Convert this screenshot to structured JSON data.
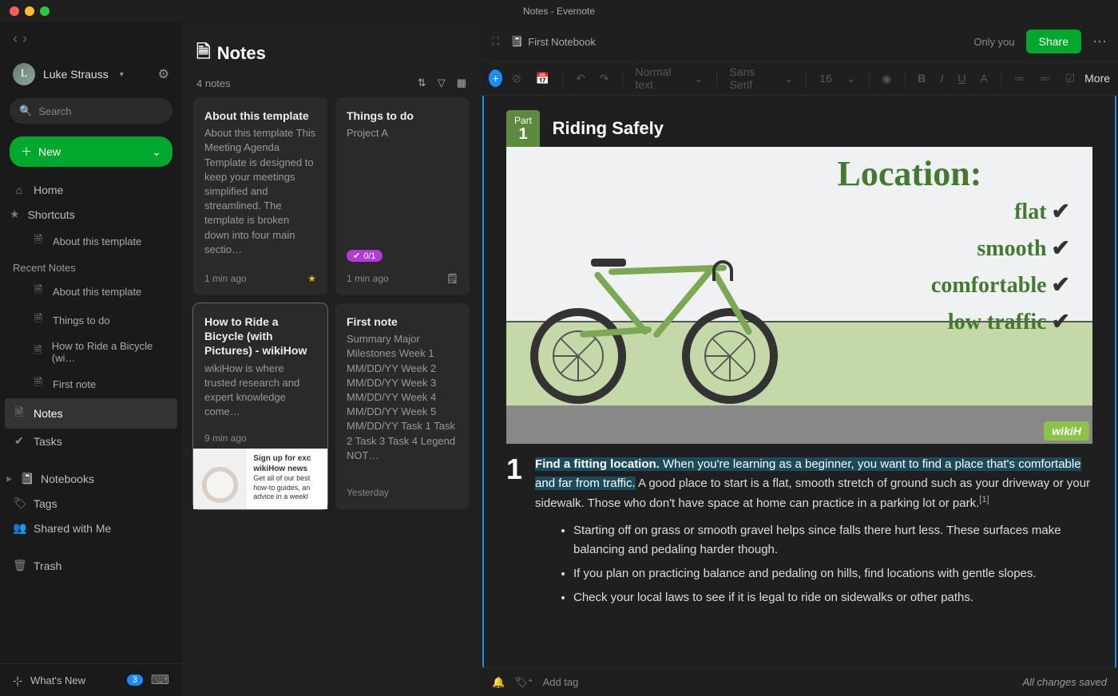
{
  "window": {
    "title": "Notes - Evernote"
  },
  "sidebar": {
    "user": "Luke Strauss",
    "user_initial": "L",
    "search_placeholder": "Search",
    "new_label": "New",
    "home": "Home",
    "shortcuts": "Shortcuts",
    "shortcut_items": [
      "About this template"
    ],
    "recent_heading": "Recent Notes",
    "recent": [
      "About this template",
      "Things to do",
      "How to Ride a Bicycle (wi…",
      "First note"
    ],
    "notes": "Notes",
    "tasks": "Tasks",
    "notebooks": "Notebooks",
    "tags": "Tags",
    "shared": "Shared with Me",
    "trash": "Trash",
    "whats_new": "What's New",
    "whats_new_badge": "3"
  },
  "notes_list": {
    "title": "Notes",
    "count": "4 notes",
    "cards": [
      {
        "title": "About this template",
        "excerpt": "About this template This Meeting Agenda Template is designed to keep your meetings simplified and streamlined. The template is broken down into four main sectio…",
        "time": "1 min ago",
        "starred": true
      },
      {
        "title": "Things to do",
        "excerpt": "Project A",
        "progress": "0/1",
        "time": "1 min ago",
        "reminder": true
      },
      {
        "title": "How to Ride a Bicycle (with Pictures) - wikiHow",
        "excerpt": "wikiHow is where trusted research and expert knowledge come…",
        "time": "9 min ago",
        "thumb_headline": "Sign up for exc wikiHow news",
        "thumb_sub": "Get all of our best how-to guides, an advice in a weekl"
      },
      {
        "title": "First note",
        "excerpt": "Summary Major Milestones Week 1 MM/DD/YY Week 2 MM/DD/YY Week 3 MM/DD/YY Week 4 MM/DD/YY Week 5 MM/DD/YY Task 1 Task 2 Task 3 Task 4 Legend NOT…",
        "time": "Yesterday"
      }
    ]
  },
  "editor": {
    "notebook": "First Notebook",
    "visibility": "Only you",
    "share": "Share",
    "toolbar": {
      "paragraph": "Normal text",
      "font": "Sans Serif",
      "size": "16",
      "more": "More"
    },
    "part_label": "Part",
    "part_num": "1",
    "doc_title": "Riding Safely",
    "illustration": {
      "location_title": "Location:",
      "items": [
        "flat",
        "smooth",
        "comfortable",
        "low traffic"
      ],
      "logo": "wikiH"
    },
    "step_num": "1",
    "step_lead_bold": "Find a fitting location.",
    "step_lead_hl": " When you're learning as a beginner, you want to find a place that's comfortable and far from traffic.",
    "step_rest": " A good place to start is a flat, smooth stretch of ground such as your driveway or your sidewalk. Those who don't have space at home can practice in a parking lot or park.",
    "citation": "[1]",
    "bullets": [
      "Starting off on grass or smooth gravel helps since falls there hurt less. These surfaces make balancing and pedaling harder though.",
      "If you plan on practicing balance and pedaling on hills, find locations with gentle slopes.",
      "Check your local laws to see if it is legal to ride on sidewalks or other paths."
    ],
    "add_tag": "Add tag",
    "save_status": "All changes saved"
  }
}
